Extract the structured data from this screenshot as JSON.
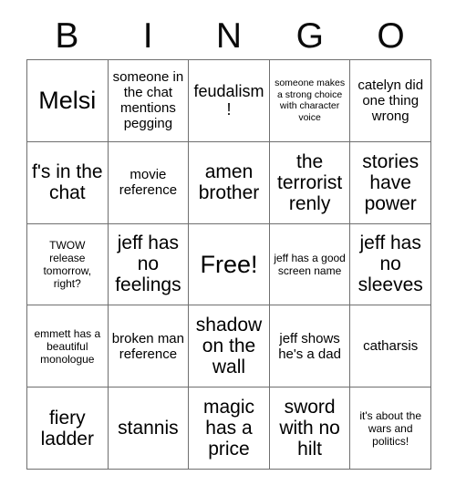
{
  "header": {
    "letters": [
      "B",
      "I",
      "N",
      "G",
      "O"
    ]
  },
  "grid": {
    "rows": 5,
    "columns": 5,
    "border_color": "#6f6f6f",
    "background_color": "#ffffff",
    "text_color": "#000000",
    "cells": [
      {
        "text": "Melsi",
        "size": "xxl"
      },
      {
        "text": "someone in the chat mentions pegging",
        "size": "md"
      },
      {
        "text": "feudalism!",
        "size": "lg"
      },
      {
        "text": "someone makes a strong choice with character voice",
        "size": "xs"
      },
      {
        "text": "catelyn did one thing wrong",
        "size": "md"
      },
      {
        "text": "f's in the chat",
        "size": "xl"
      },
      {
        "text": "movie reference",
        "size": "md"
      },
      {
        "text": "amen brother",
        "size": "xl"
      },
      {
        "text": "the terrorist renly",
        "size": "xl"
      },
      {
        "text": "stories have power",
        "size": "xl"
      },
      {
        "text": "TWOW release tomorrow, right?",
        "size": "sm"
      },
      {
        "text": "jeff has no feelings",
        "size": "xl"
      },
      {
        "text": "Free!",
        "size": "xxl"
      },
      {
        "text": "jeff has a good screen name",
        "size": "sm"
      },
      {
        "text": "jeff has no sleeves",
        "size": "xl"
      },
      {
        "text": "emmett has a beautiful monologue",
        "size": "sm"
      },
      {
        "text": "broken man reference",
        "size": "md"
      },
      {
        "text": "shadow on the wall",
        "size": "xl"
      },
      {
        "text": "jeff shows he's a dad",
        "size": "md"
      },
      {
        "text": "catharsis",
        "size": "md"
      },
      {
        "text": "fiery ladder",
        "size": "xl"
      },
      {
        "text": "stannis",
        "size": "xl"
      },
      {
        "text": "magic has a price",
        "size": "xl"
      },
      {
        "text": "sword with no hilt",
        "size": "xl"
      },
      {
        "text": "it's about the wars and politics!",
        "size": "sm"
      }
    ]
  }
}
